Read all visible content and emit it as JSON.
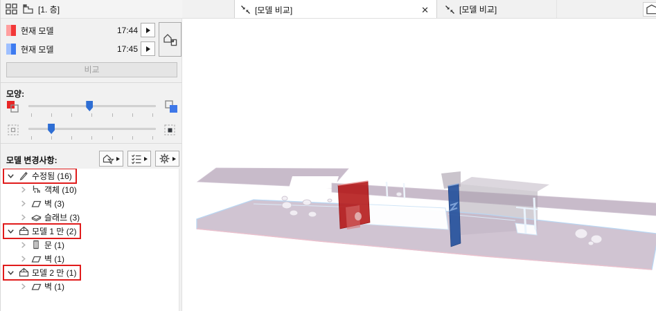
{
  "navigator": {
    "story_tab": "[1. 층]"
  },
  "compare_panel": {
    "model_rows": [
      {
        "name": "현재 모델",
        "time": "17:44",
        "swatch_light": "#ff9f9f",
        "swatch_dark": "#f23838"
      },
      {
        "name": "현재 모델",
        "time": "17:45",
        "swatch_light": "#9fc0ff",
        "swatch_dark": "#3d7bf0"
      }
    ],
    "compare_button": "비교"
  },
  "appearance": {
    "section_label": "모양:",
    "color_slider_percent": 48,
    "transparency_slider_percent": 18,
    "tick_count": 7
  },
  "changes": {
    "section_label": "모델 변경사항:"
  },
  "tree": {
    "highlight_color": "#e01b1b",
    "items": [
      {
        "level": 0,
        "icon": "pencil",
        "label": "수정됨",
        "count": "(16)",
        "expanded": true,
        "highlighted": true
      },
      {
        "level": 1,
        "icon": "object",
        "label": "객체",
        "count": "(10)",
        "expanded": false,
        "highlighted": false
      },
      {
        "level": 1,
        "icon": "wall",
        "label": "벽",
        "count": "(3)",
        "expanded": false,
        "highlighted": false
      },
      {
        "level": 1,
        "icon": "slab",
        "label": "슬래브",
        "count": "(3)",
        "expanded": false,
        "highlighted": false
      },
      {
        "level": 0,
        "icon": "house",
        "label": "모델 1 만",
        "count": "(2)",
        "expanded": true,
        "highlighted": true
      },
      {
        "level": 1,
        "icon": "door",
        "label": "문",
        "count": "(1)",
        "expanded": false,
        "highlighted": false
      },
      {
        "level": 1,
        "icon": "wall",
        "label": "벽",
        "count": "(1)",
        "expanded": false,
        "highlighted": false
      },
      {
        "level": 0,
        "icon": "house",
        "label": "모델 2 만",
        "count": "(1)",
        "expanded": true,
        "highlighted": true
      },
      {
        "level": 1,
        "icon": "wall",
        "label": "벽",
        "count": "(1)",
        "expanded": false,
        "highlighted": false
      }
    ]
  },
  "tabbar": {
    "close_glyph": "✕",
    "tabs": [
      {
        "label": "[모델 비교]",
        "active": true,
        "closable": true
      },
      {
        "label": "[모델 비교]",
        "active": false,
        "closable": false
      }
    ]
  },
  "scene_colors": {
    "slab": "#c4b5c7",
    "edge": "#bcd8f2",
    "red_wall": "#b31414",
    "blue_wall": "#25519c",
    "front_edge": "#ecc0cc"
  }
}
